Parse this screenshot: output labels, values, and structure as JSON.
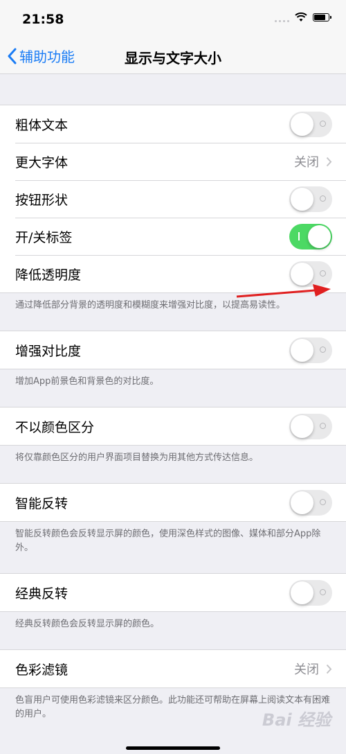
{
  "status": {
    "time": "21:58"
  },
  "nav": {
    "back_label": "辅助功能",
    "title": "显示与文字大小"
  },
  "groups": [
    {
      "rows": [
        {
          "label": "粗体文本",
          "toggle": "off"
        },
        {
          "label": "更大字体",
          "value": "关闭"
        },
        {
          "label": "按钮形状",
          "toggle": "off"
        },
        {
          "label": "开/关标签",
          "toggle": "on"
        },
        {
          "label": "降低透明度",
          "toggle": "off"
        }
      ],
      "footnote": "通过降低部分背景的透明度和模糊度来增强对比度，以提高易读性。"
    },
    {
      "rows": [
        {
          "label": "增强对比度",
          "toggle": "off"
        }
      ],
      "footnote": "增加App前景色和背景色的对比度。"
    },
    {
      "rows": [
        {
          "label": "不以颜色区分",
          "toggle": "off"
        }
      ],
      "footnote": "将仅靠颜色区分的用户界面项目替换为用其他方式传达信息。"
    },
    {
      "rows": [
        {
          "label": "智能反转",
          "toggle": "off"
        }
      ],
      "footnote": "智能反转颜色会反转显示屏的颜色，使用深色样式的图像、媒体和部分App除外。"
    },
    {
      "rows": [
        {
          "label": "经典反转",
          "toggle": "off"
        }
      ],
      "footnote": "经典反转颜色会反转显示屏的颜色。"
    },
    {
      "rows": [
        {
          "label": "色彩滤镜",
          "value": "关闭"
        }
      ],
      "footnote": "色盲用户可使用色彩滤镜来区分颜色。此功能还可帮助在屏幕上阅读文本有困难的用户。"
    }
  ],
  "watermark": "Bai 经验",
  "colors": {
    "accent": "#1a7cf5",
    "toggle_on": "#4cd964",
    "annotation_arrow": "#e02020"
  }
}
